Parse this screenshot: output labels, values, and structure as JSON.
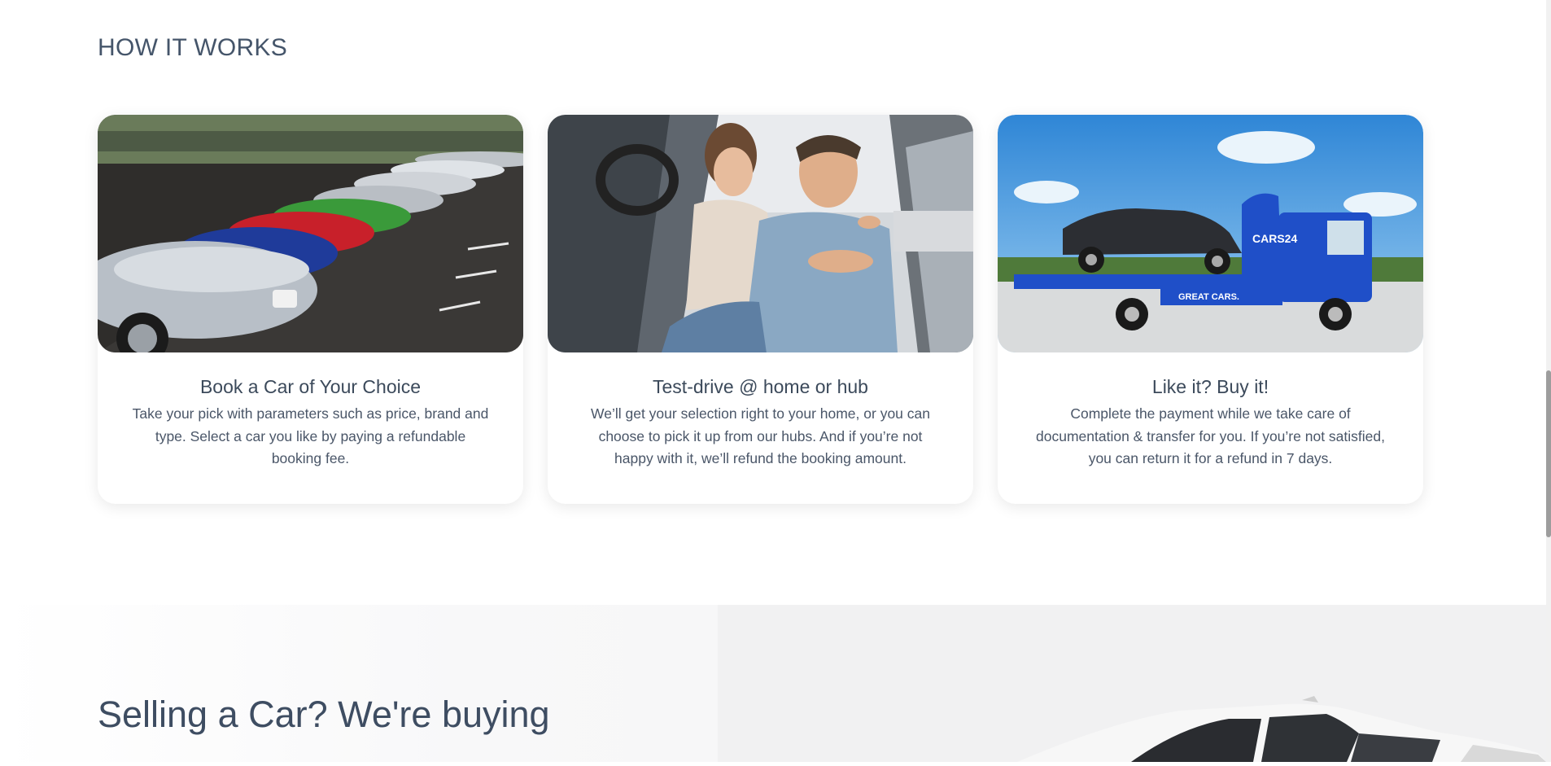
{
  "how_it_works": {
    "title": "HOW IT WORKS",
    "cards": [
      {
        "image": "car-parking-lot-photo",
        "title": "Book a Car of Your Choice",
        "text": "Take your pick with parameters such as price, brand and type. Select a car you like by paying a refundable booking fee."
      },
      {
        "image": "test-drive-couple-photo",
        "title": "Test-drive @ home or hub",
        "text": "We’ll get your selection right to your home, or you can choose to pick it up from our hubs. And if you’re not happy with it, we’ll refund the booking amount."
      },
      {
        "image": "delivery-truck-photo",
        "title": "Like it? Buy it!",
        "text": "Complete the payment while we take care of documentation & transfer for you. If you’re not satisfied, you can return it for a refund in 7 days.",
        "truck_brand": "CARS24",
        "truck_slogan": "GREAT CARS."
      }
    ]
  },
  "sell_section": {
    "title": "Selling a Car? We're buying"
  },
  "colors": {
    "heading": "#45556a",
    "body_text": "#4a5668",
    "truck_blue": "#1f4fc8"
  }
}
